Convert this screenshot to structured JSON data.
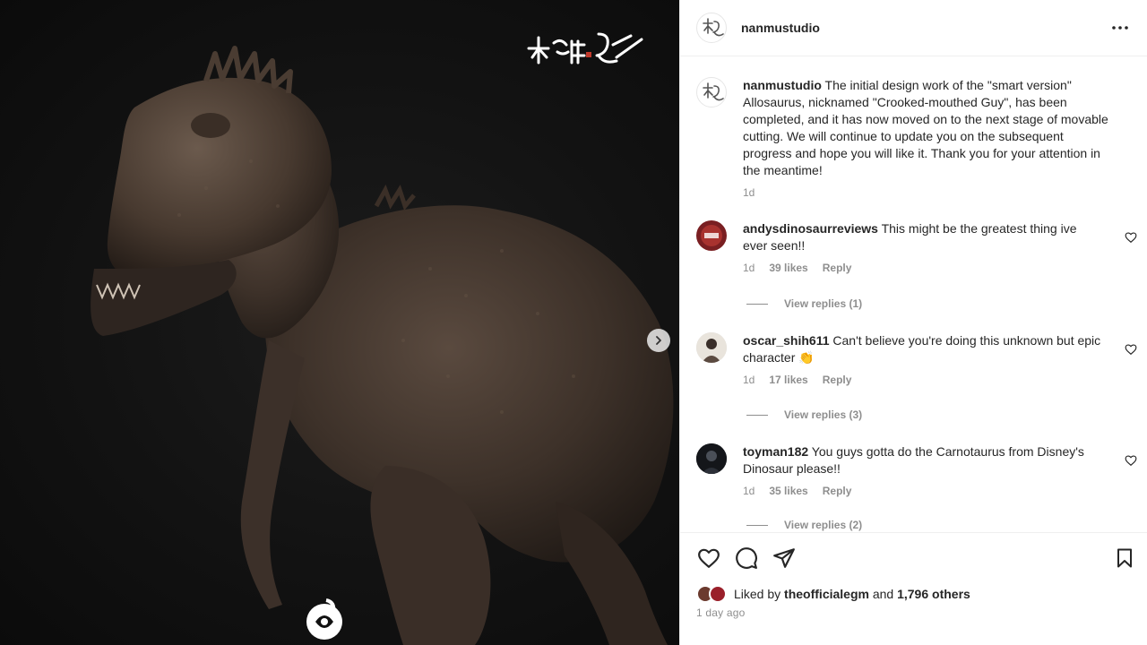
{
  "header": {
    "username": "nanmustudio"
  },
  "caption": {
    "username": "nanmustudio",
    "lines": [
      "The initial design work of the \"smart version\"",
      "Allosaurus, nicknamed \"Crooked-mouthed Guy\", has been",
      "completed, and it has now moved on to the next stage of movable",
      "cutting. We will continue to update you on the subsequent",
      "progress and hope you will like it. Thank you for your attention in",
      "the meantime!"
    ],
    "time": "1d"
  },
  "comments": [
    {
      "username": "andysdinosaurreviews",
      "lines": [
        "This might be the greatest thing ive",
        "ever seen!!"
      ],
      "time": "1d",
      "likes": "39 likes",
      "reply_label": "Reply",
      "view_replies": "View replies (1)"
    },
    {
      "username": "oscar_shih611",
      "lines": [
        "Can't believe you're doing this unknown but epic",
        "character 👏"
      ],
      "time": "1d",
      "likes": "17 likes",
      "reply_label": "Reply",
      "view_replies": "View replies (3)"
    },
    {
      "username": "toyman182",
      "lines": [
        "You guys gotta do the Carnotaurus from Disney's",
        "Dinosaur please!!"
      ],
      "time": "1d",
      "likes": "35 likes",
      "reply_label": "Reply",
      "view_replies": "View replies (2)"
    }
  ],
  "likes": {
    "prefix": "Liked by",
    "user": "theofficialegm",
    "joiner": "and",
    "others": "1,796 others"
  },
  "timestamp": "1 day ago",
  "icons": {
    "more": "more-horizontal-icon",
    "like": "heart-icon",
    "comment": "comment-icon",
    "share": "share-icon",
    "save": "bookmark-icon",
    "next": "chevron-right-icon"
  },
  "colors": {
    "text": "#262626",
    "muted": "#8e8e8e",
    "divider": "#efefef",
    "media_bg": "#121212"
  }
}
